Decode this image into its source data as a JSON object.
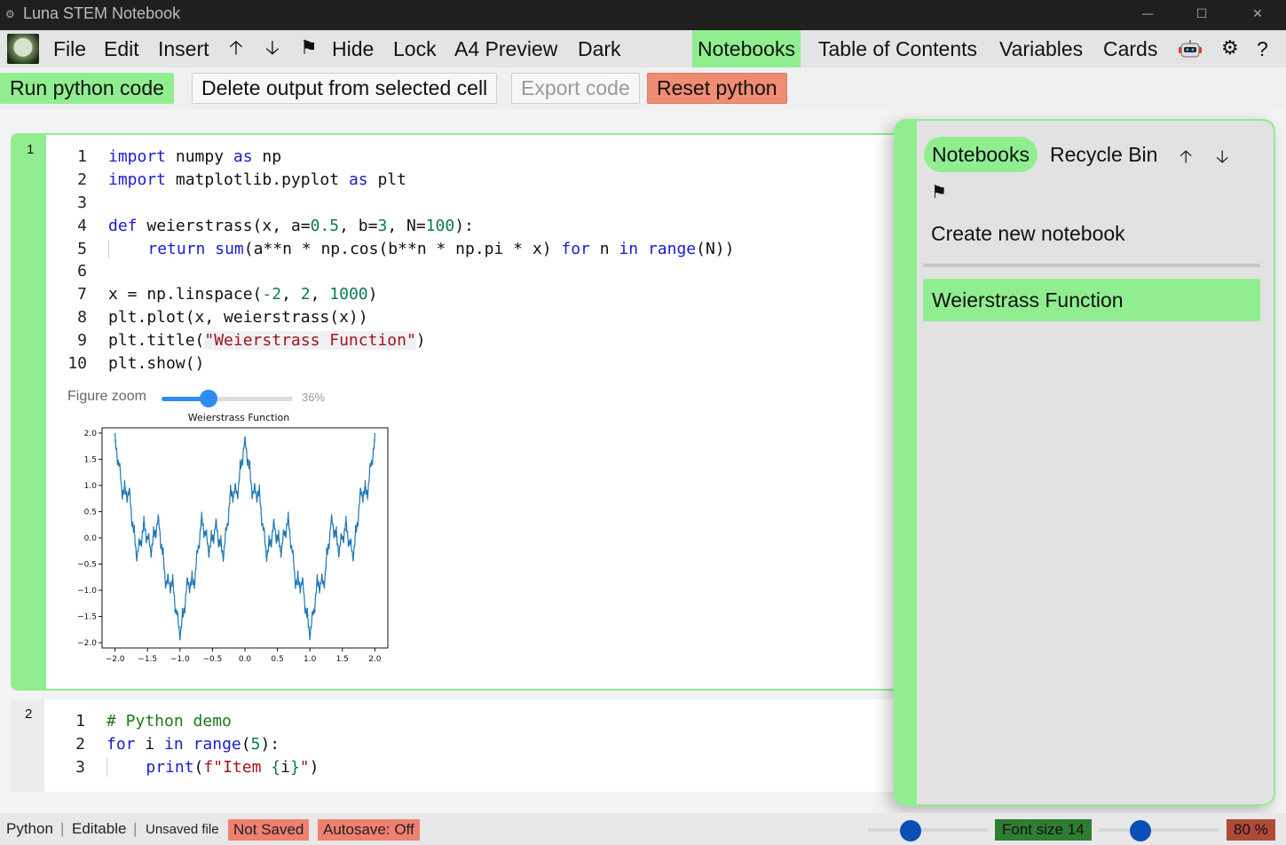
{
  "app": {
    "title": "Luna STEM Notebook"
  },
  "window_controls": {
    "minimize": "—",
    "maximize": "☐",
    "close": "✕"
  },
  "menu": {
    "items": [
      "File",
      "Edit",
      "Insert",
      "Hide",
      "Lock",
      "A4 Preview",
      "Dark"
    ],
    "icons": {
      "up": "🡡",
      "down": "🡣",
      "flag": "⚑"
    },
    "right_items": [
      "Notebooks",
      "Table of Contents",
      "Variables",
      "Cards"
    ],
    "active_right": "Notebooks",
    "settings_icon": "⚙",
    "help": "?"
  },
  "toolbar": {
    "run": "Run python code",
    "delete_output": "Delete output from selected cell",
    "export": "Export code",
    "reset": "Reset python"
  },
  "cells": [
    {
      "number": "1",
      "lines": [
        {
          "n": "1"
        },
        {
          "n": "2"
        },
        {
          "n": "3"
        },
        {
          "n": "4"
        },
        {
          "n": "5"
        },
        {
          "n": "6"
        },
        {
          "n": "7"
        },
        {
          "n": "8"
        },
        {
          "n": "9"
        },
        {
          "n": "10"
        }
      ],
      "figure_zoom_label": "Figure zoom",
      "figure_zoom_value": "36%",
      "figure_zoom_fraction": 0.36
    },
    {
      "number": "2",
      "lines": [
        {
          "n": "1"
        },
        {
          "n": "2"
        },
        {
          "n": "3"
        }
      ]
    }
  ],
  "chart_data": {
    "type": "line",
    "title": "Weierstrass Function",
    "xlabel": "",
    "ylabel": "",
    "xlim": [
      -2.2,
      2.2
    ],
    "ylim": [
      -2.1,
      2.1
    ],
    "xticks": [
      "−2.0",
      "−1.5",
      "−1.0",
      "−0.5",
      "0.0",
      "0.5",
      "1.0",
      "1.5",
      "2.0"
    ],
    "yticks": [
      "−2.0",
      "−1.5",
      "−1.0",
      "−0.5",
      "0.0",
      "0.5",
      "1.0",
      "1.5",
      "2.0"
    ],
    "series": [
      {
        "function": "sum(0.5**n * cos(3**n * pi * x) for n in range(100))",
        "x_range": [
          -2,
          2
        ],
        "points": 1000,
        "color": "#1f77b4"
      }
    ]
  },
  "side_panel": {
    "tabs": [
      "Notebooks",
      "Recycle Bin"
    ],
    "active_tab": "Notebooks",
    "create": "Create new notebook",
    "notebooks": [
      "Weierstrass Function"
    ]
  },
  "status": {
    "language": "Python",
    "mode": "Editable",
    "file": "Unsaved file",
    "saved": "Not Saved",
    "autosave": "Autosave: Off",
    "font_size": "Font size 14",
    "font_slider_fraction": 0.35,
    "zoom": "80 %",
    "zoom_slider_fraction": 0.35
  },
  "colors": {
    "accent": "#90ee90",
    "danger": "#f08070",
    "slider": "#0a4fb3"
  }
}
